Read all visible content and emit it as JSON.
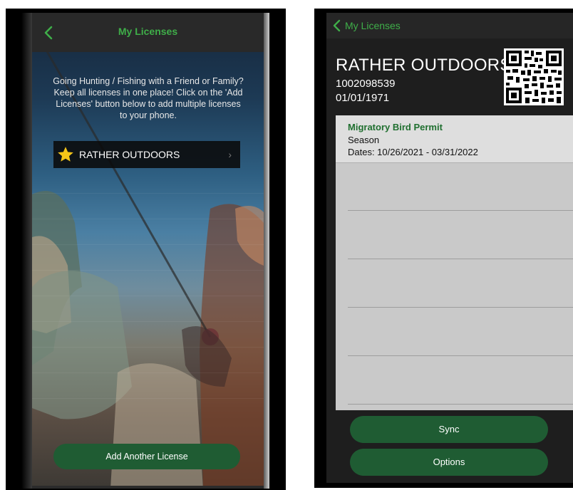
{
  "left_screen": {
    "title": "My Licenses",
    "info_text": "Going Hunting / Fishing with a Friend or Family? Keep all licenses in one place! Click on the 'Add Licenses' button below to add multiple licenses to your phone.",
    "license_items": [
      {
        "name": "RATHER OUTDOORS",
        "icon": "star-icon"
      }
    ],
    "add_button_label": "Add Another License",
    "colors": {
      "accent": "#3fae49",
      "button": "#1f5c33",
      "navbar": "#292929"
    }
  },
  "right_screen": {
    "back_label": "My Licenses",
    "holder": {
      "name": "RATHER OUTDOORS",
      "id": "1002098539",
      "dob": "01/01/1971"
    },
    "permit": {
      "name": "Migratory Bird Permit",
      "type": "Season",
      "dates": "Dates: 10/26/2021 - 03/31/2022"
    },
    "sync_label": "Sync",
    "options_label": "Options",
    "colors": {
      "permit_title": "#1f6f2f",
      "panel": "#c9c9c9",
      "button": "#1f5c33"
    }
  }
}
